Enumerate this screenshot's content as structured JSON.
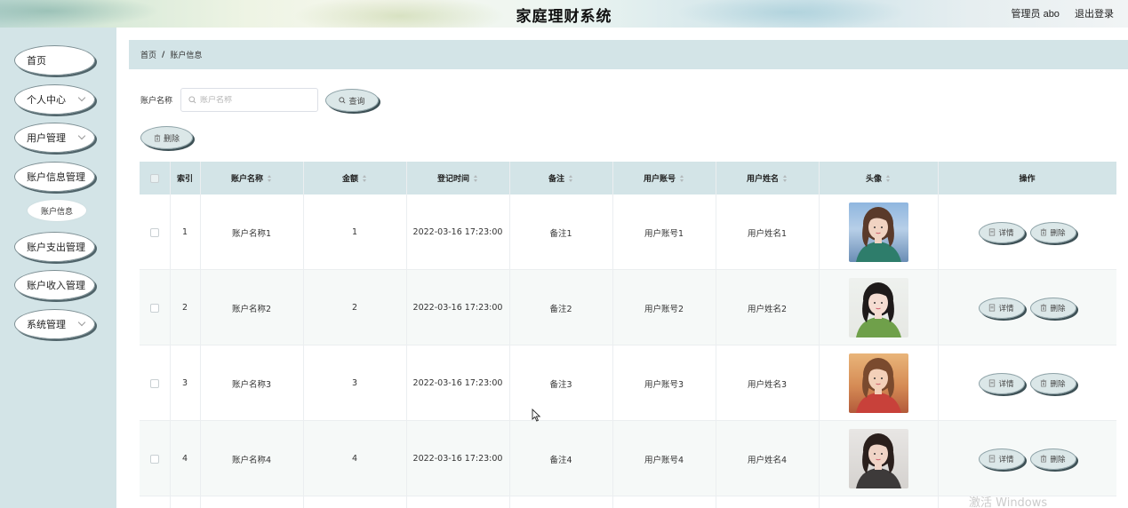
{
  "header": {
    "title": "家庭理财系统",
    "user_label": "管理员 abo",
    "logout_label": "退出登录"
  },
  "sidebar": {
    "items": [
      {
        "label": "首页",
        "has_arrow": false
      },
      {
        "label": "个人中心",
        "has_arrow": true
      },
      {
        "label": "用户管理",
        "has_arrow": true
      },
      {
        "label": "账户信息管理",
        "has_arrow": false
      },
      {
        "label": "账户支出管理",
        "has_arrow": false
      },
      {
        "label": "账户收入管理",
        "has_arrow": false
      },
      {
        "label": "系统管理",
        "has_arrow": true
      }
    ],
    "sub_item": "账户信息"
  },
  "breadcrumb": {
    "home": "首页",
    "separator": "/",
    "current": "账户信息"
  },
  "search": {
    "label": "账户名称",
    "placeholder": "账户名称",
    "value": "",
    "search_button": "查询",
    "delete_button": "删除"
  },
  "table": {
    "columns": [
      "索引",
      "账户名称",
      "金额",
      "登记时间",
      "备注",
      "用户账号",
      "用户姓名",
      "头像",
      "操作"
    ],
    "rows": [
      {
        "index": "1",
        "name": "账户名称1",
        "amount": "1",
        "time": "2022-03-16 17:23:00",
        "note": "备注1",
        "account": "用户账号1",
        "username": "用户姓名1"
      },
      {
        "index": "2",
        "name": "账户名称2",
        "amount": "2",
        "time": "2022-03-16 17:23:00",
        "note": "备注2",
        "account": "用户账号2",
        "username": "用户姓名2"
      },
      {
        "index": "3",
        "name": "账户名称3",
        "amount": "3",
        "time": "2022-03-16 17:23:00",
        "note": "备注3",
        "account": "用户账号3",
        "username": "用户姓名3"
      },
      {
        "index": "4",
        "name": "账户名称4",
        "amount": "4",
        "time": "2022-03-16 17:23:00",
        "note": "备注4",
        "account": "用户账号4",
        "username": "用户姓名4"
      }
    ],
    "detail_button": "详情",
    "delete_button": "删除"
  },
  "watermark": "激活 Windows",
  "colors": {
    "sidebar_bg": "#d3e4e7",
    "button_bg": "#dbe7e8",
    "button_shadow": "#3e5156"
  }
}
